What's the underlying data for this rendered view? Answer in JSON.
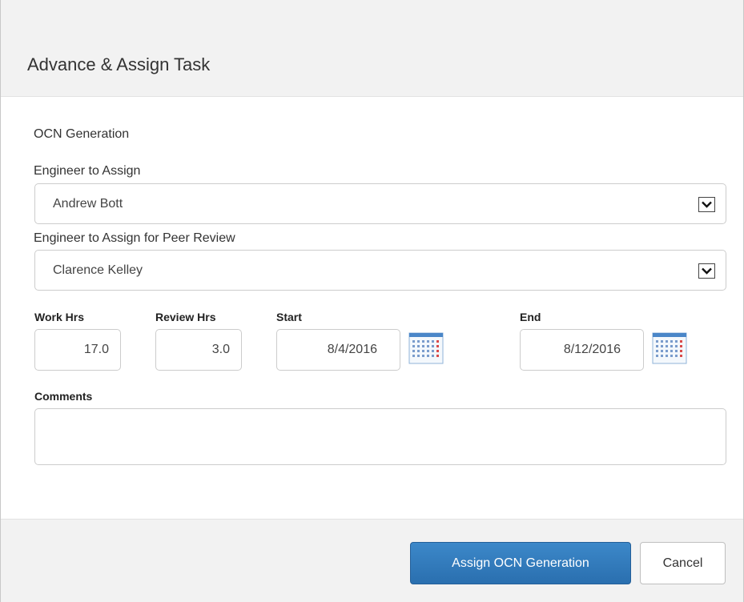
{
  "dialog": {
    "title": "Advance & Assign Task"
  },
  "form": {
    "task_name": "OCN Generation",
    "engineer_label": "Engineer to Assign",
    "engineer_value": "Andrew Bott",
    "peer_label": "Engineer to Assign for Peer Review",
    "peer_value": "Clarence Kelley",
    "work_hrs_label": "Work Hrs",
    "work_hrs_value": "17.0",
    "review_hrs_label": "Review Hrs",
    "review_hrs_value": "3.0",
    "start_label": "Start",
    "start_value": "8/4/2016",
    "end_label": "End",
    "end_value": "8/12/2016",
    "comments_label": "Comments",
    "comments_value": ""
  },
  "footer": {
    "assign_label": "Assign OCN Generation",
    "cancel_label": "Cancel"
  },
  "icons": {
    "dropdown": "chevron-down-icon",
    "calendar": "calendar-icon"
  },
  "colors": {
    "primary": "#337ab7",
    "header_bg": "#f2f2f2"
  }
}
